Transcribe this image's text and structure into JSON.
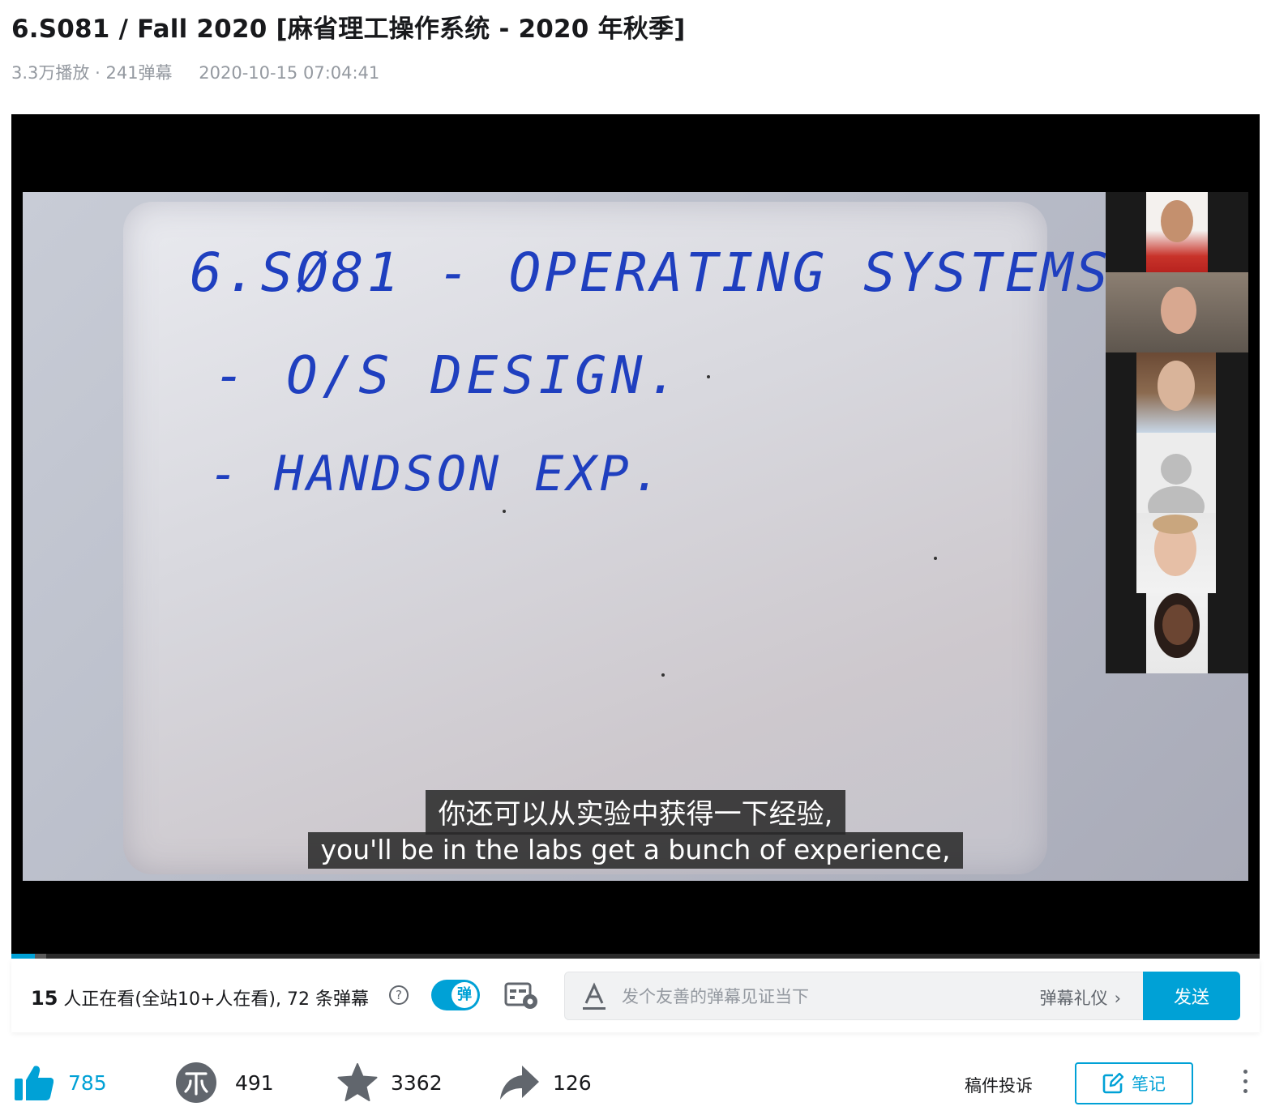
{
  "video": {
    "title": "6.S081 / Fall 2020 [麻省理工操作系统 - 2020 年秋季]",
    "play_count": "3.3万播放",
    "separator": "·",
    "danmaku_count": "241弹幕",
    "publish_time": "2020-10-15 07:04:41"
  },
  "whiteboard": {
    "line1": "6.SØ81 - OPERATING SYSTEMS",
    "line2": "- O/S DESIGN.",
    "line3": "- HANDSON EXP."
  },
  "subtitles": {
    "zh": "你还可以从实验中获得一下经验,",
    "en": "you'll be in the labs get a bunch of experience,"
  },
  "playback": {
    "progress_fraction": 0.019,
    "buffered_fraction": 0.028
  },
  "danmaku_bar": {
    "viewer_count": "15",
    "viewer_text": " 人正在看(全站10+人在看), 72 条弹幕",
    "toggle_label": "弹",
    "input_placeholder": "发个友善的弹幕见证当下",
    "etiquette_label": "弹幕礼仪",
    "send_label": "发送"
  },
  "toolbar": {
    "like_count": "785",
    "coin_count": "491",
    "favorite_count": "3362",
    "share_count": "126",
    "report_label": "稿件投诉",
    "note_label": "笔记"
  },
  "colors": {
    "accent": "#00a1d6",
    "ink": "#1f3fbf",
    "text": "#18191c",
    "muted": "#9499a0"
  }
}
